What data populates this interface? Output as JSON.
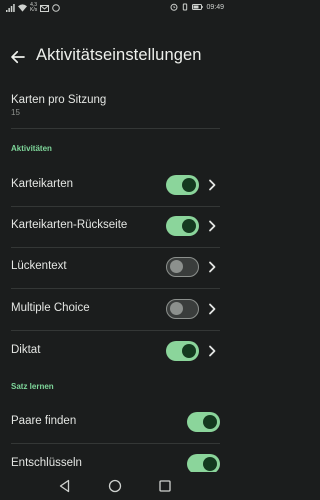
{
  "status": {
    "speed": "4,3",
    "speed_unit": "K/s",
    "time": "09:49"
  },
  "header": {
    "title": "Aktivitätseinstellungen",
    "back_icon": "arrow-left-icon"
  },
  "cards_per_session": {
    "label": "Karten pro Sitzung",
    "value": "15"
  },
  "sections": {
    "activities": "Aktivitäten",
    "learn_set": "Satz lernen"
  },
  "activities": [
    {
      "label": "Karteikarten",
      "enabled": true
    },
    {
      "label": "Karteikarten-Rückseite",
      "enabled": true
    },
    {
      "label": "Lückentext",
      "enabled": false
    },
    {
      "label": "Multiple Choice",
      "enabled": false
    },
    {
      "label": "Diktat",
      "enabled": true
    }
  ],
  "learn_set": [
    {
      "label": "Paare finden",
      "enabled": true
    },
    {
      "label": "Entschlüsseln",
      "enabled": true
    }
  ],
  "colors": {
    "background": "#1b1d1d",
    "accent": "#8bd59b",
    "section": "#7ed69a"
  }
}
